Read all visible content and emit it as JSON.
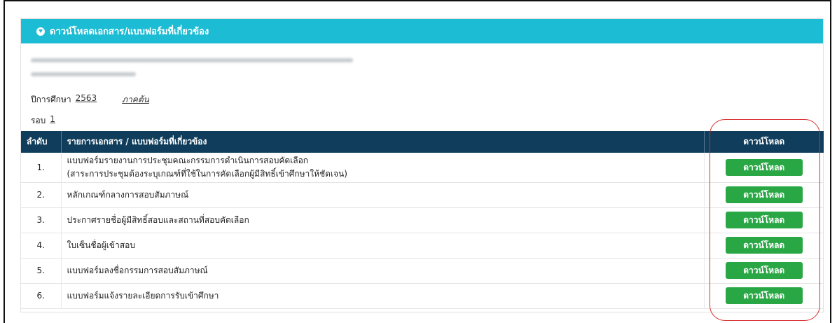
{
  "panel": {
    "title": "ดาวน์โหลดเอกสาร/แบบฟอร์มที่เกี่ยวข้อง",
    "title_icon": "circle-arrow-down-icon"
  },
  "meta": {
    "year_label": "ปีการศึกษา",
    "year_value": "2563",
    "semester_value": "ภาคต้น",
    "round_label": "รอบ",
    "round_value": "1"
  },
  "table": {
    "headers": [
      "ลำดับ",
      "รายการเอกสาร / แบบฟอร์มที่เกี่ยวข้อง",
      "ดาวน์โหลด"
    ],
    "rows": [
      {
        "no": "1.",
        "title": "แบบฟอร์มรายงานการประชุมคณะกรรมการดำเนินการสอบคัดเลือก",
        "subtitle": "(สาระการประชุมต้องระบุเกณฑ์ที่ใช้ในการคัดเลือกผู้มีสิทธิ์เข้าศึกษาให้ชัดเจน)",
        "action": "ดาวน์โหลด"
      },
      {
        "no": "2.",
        "title": "หลักเกณฑ์กลางการสอบสัมภาษณ์",
        "action": "ดาวน์โหลด"
      },
      {
        "no": "3.",
        "title": "ประกาศรายชื่อผู้มีสิทธิ์สอบและสถานที่สอบคัดเลือก",
        "action": "ดาวน์โหลด"
      },
      {
        "no": "4.",
        "title": "ใบเซ็นชื่อผู้เข้าสอบ",
        "action": "ดาวน์โหลด"
      },
      {
        "no": "5.",
        "title": "แบบฟอร์มลงชื่อกรรมการสอบสัมภาษณ์",
        "action": "ดาวน์โหลด"
      },
      {
        "no": "6.",
        "title": "แบบฟอร์มแจ้งรายละเอียดการรับเข้าศึกษา",
        "action": "ดาวน์โหลด"
      }
    ]
  },
  "colors": {
    "header_bar": "#1cbcd4",
    "table_header": "#0f3d5b",
    "button": "#29a745",
    "highlight": "#d82c2c"
  }
}
